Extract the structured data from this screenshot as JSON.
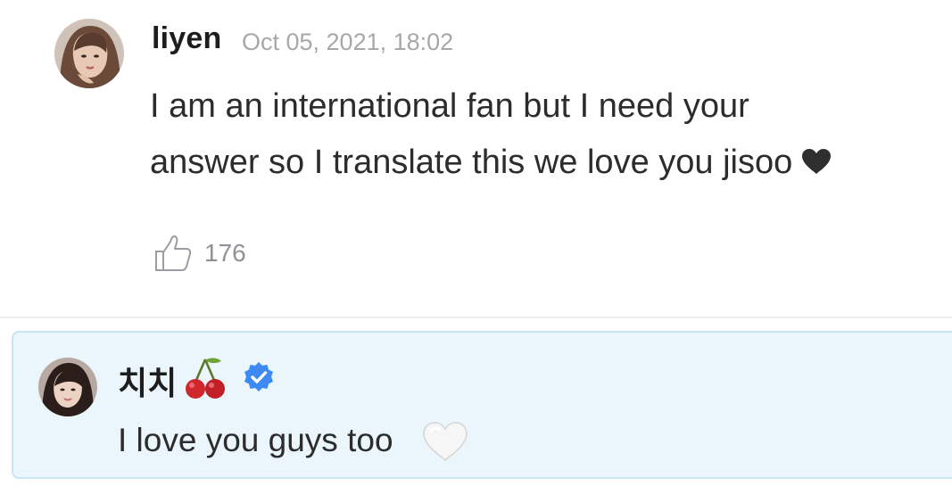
{
  "comment": {
    "avatar_icon": "user-avatar-liyen",
    "username": "liyen",
    "timestamp": "Oct 05, 2021, 18:02",
    "body_line1": "I am an international fan but I need your",
    "body_line2": "answer so I translate this we love you jisoo",
    "body_emoji": "black-heart-icon",
    "like_icon": "thumbs-up-icon",
    "like_count": "176"
  },
  "reply": {
    "avatar_icon": "user-avatar-chichi",
    "name": "치치",
    "name_emoji": "cherry-icon",
    "verified_icon": "verified-badge-icon",
    "body": "I love you guys too",
    "body_emoji": "white-heart-icon"
  },
  "colors": {
    "username": "#1d1d1d",
    "timestamp": "#a6a8ab",
    "body_text": "#2c2c2c",
    "like_text": "#8e9195",
    "reply_background": "#eaf6fb",
    "reply_border": "#c9e5f1",
    "verified_blue": "#3d8bf2"
  }
}
